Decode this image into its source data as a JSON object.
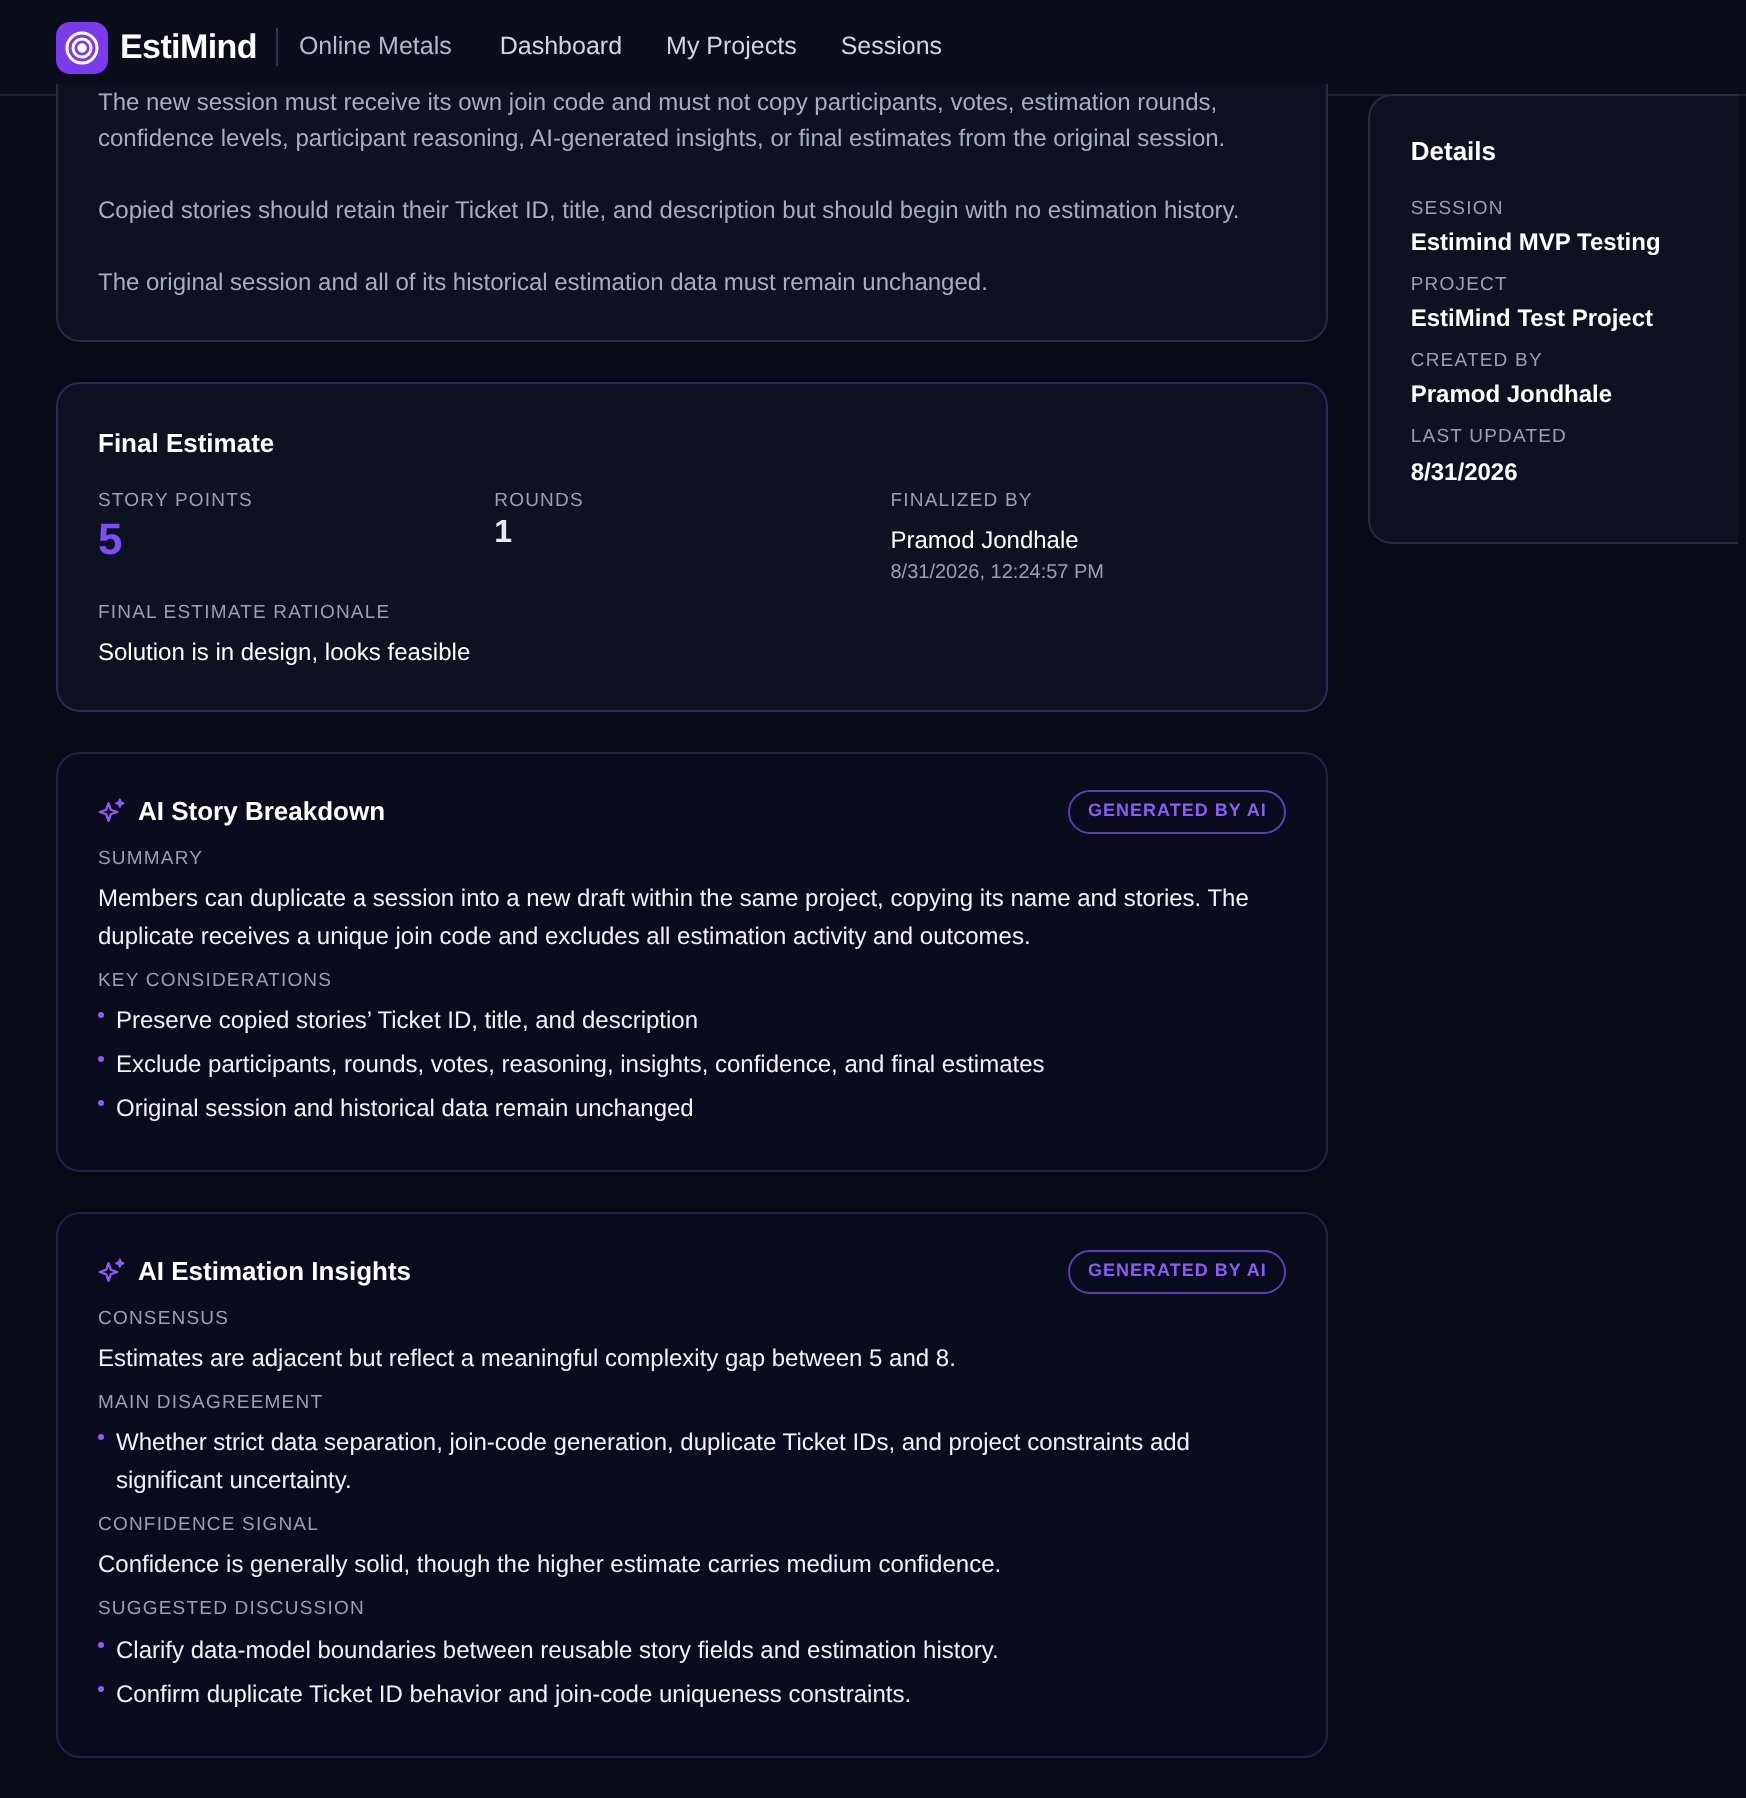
{
  "navbar": {
    "brand": "EstiMind",
    "organization": "Online Metals",
    "links": [
      "Dashboard",
      "My Projects",
      "Sessions"
    ]
  },
  "description": {
    "paragraphs": [
      "The new session must receive its own join code and must not copy participants, votes, estimation rounds, confidence levels, participant reasoning, AI-generated insights, or final estimates from the original session.",
      "Copied stories should retain their Ticket ID, title, and description but should begin with no estimation history.",
      "The original session and all of its historical estimation data must remain unchanged."
    ]
  },
  "final_estimate": {
    "title": "Final Estimate",
    "story_points_label": "STORY POINTS",
    "story_points": "5",
    "rounds_label": "ROUNDS",
    "rounds": "1",
    "finalized_by_label": "FINALIZED BY",
    "finalized_by": "Pramod Jondhale",
    "finalized_at": "8/31/2026, 12:24:57 PM",
    "rationale_label": "FINAL ESTIMATE RATIONALE",
    "rationale": "Solution is in design, looks feasible"
  },
  "ai_cards": [
    {
      "title": "AI Story Breakdown",
      "badge": "GENERATED BY AI",
      "sections": [
        {
          "kind": "text",
          "label": "SUMMARY",
          "text": "Members can duplicate a session into a new draft within the same project, copying its name and stories. The duplicate receives a unique join code and excludes all estimation activity and outcomes."
        },
        {
          "kind": "list",
          "label": "KEY CONSIDERATIONS",
          "items": [
            "Preserve copied stories’ Ticket ID, title, and description",
            "Exclude participants, rounds, votes, reasoning, insights, confidence, and final estimates",
            "Original session and historical data remain unchanged"
          ]
        }
      ]
    },
    {
      "title": "AI Estimation Insights",
      "badge": "GENERATED BY AI",
      "sections": [
        {
          "kind": "text",
          "label": "CONSENSUS",
          "text": "Estimates are adjacent but reflect a meaningful complexity gap between 5 and 8."
        },
        {
          "kind": "list",
          "label": "MAIN DISAGREEMENT",
          "items": [
            "Whether strict data separation, join-code generation, duplicate Ticket IDs, and project constraints add significant uncertainty."
          ]
        },
        {
          "kind": "text",
          "label": "CONFIDENCE SIGNAL",
          "text": "Confidence is generally solid, though the higher estimate carries medium confidence."
        },
        {
          "kind": "list",
          "label": "SUGGESTED DISCUSSION",
          "items": [
            "Clarify data-model boundaries between reusable story fields and estimation history.",
            "Confirm duplicate Ticket ID behavior and join-code uniqueness constraints."
          ]
        }
      ]
    }
  ],
  "details": {
    "title": "Details",
    "fields": [
      {
        "label": "SESSION",
        "value": "Estimind MVP Testing"
      },
      {
        "label": "PROJECT",
        "value": "EstiMind Test Project"
      },
      {
        "label": "CREATED BY",
        "value": "Pramod Jondhale"
      },
      {
        "label": "LAST UPDATED",
        "value": "8/31/2026"
      }
    ]
  }
}
